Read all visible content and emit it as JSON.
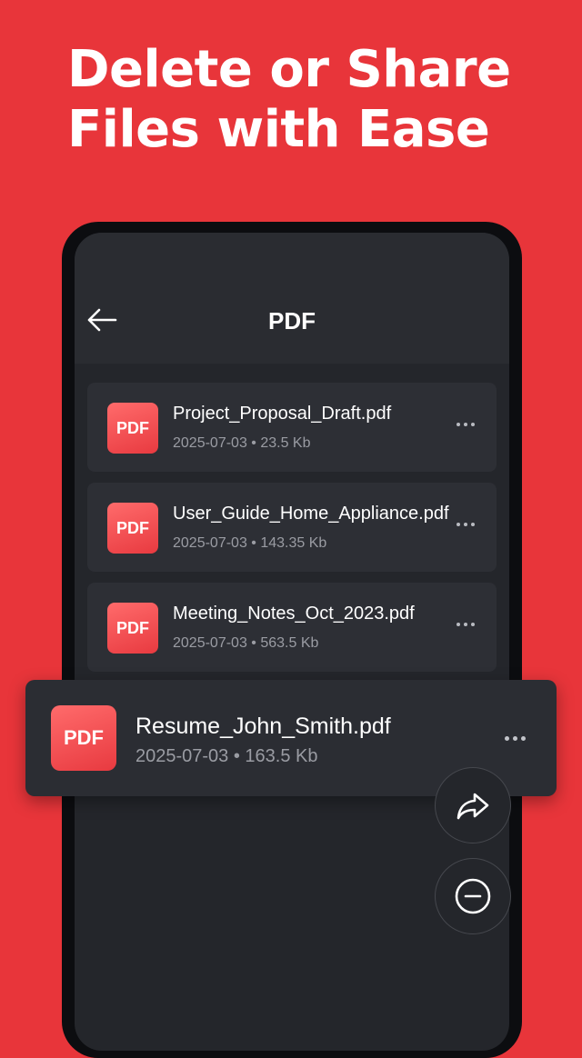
{
  "promo": {
    "headline_line1": "Delete or Share",
    "headline_line2": "Files with Ease"
  },
  "appbar": {
    "back_icon": "arrow-left-icon",
    "title": "PDF"
  },
  "files": [
    {
      "badge": "PDF",
      "name": "Project_Proposal_Draft.pdf",
      "meta": "2025-07-03 • 23.5 Kb"
    },
    {
      "badge": "PDF",
      "name": "User_Guide_Home_Appliance.pdf",
      "meta": "2025-07-03  • 143.35 Kb"
    },
    {
      "badge": "PDF",
      "name": "Meeting_Notes_Oct_2023.pdf",
      "meta": "2025-07-03 • 563.5 Kb"
    }
  ],
  "selected_file": {
    "badge": "PDF",
    "name": "Resume_John_Smith.pdf",
    "meta": "2025-07-03 • 163.5 Kb"
  },
  "actions": {
    "share_icon": "share-icon",
    "delete_icon": "minus-circle-icon"
  },
  "colors": {
    "background": "#e8353a",
    "screen": "#24262b",
    "card": "#2d2f35",
    "badge": "#f0474c"
  }
}
